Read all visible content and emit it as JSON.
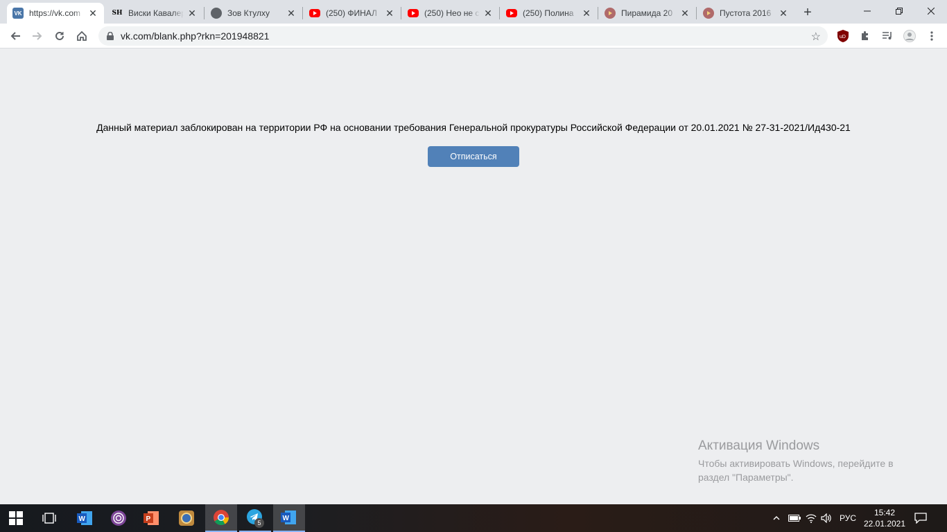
{
  "tabs": [
    {
      "title": "https://vk.com",
      "favicon": "vk-icon",
      "active": true
    },
    {
      "title": "Виски Кавалер",
      "favicon": "sh-icon",
      "active": false
    },
    {
      "title": "Зов Ктулху",
      "favicon": "globe-icon",
      "active": false
    },
    {
      "title": "(250) ФИНАЛ",
      "favicon": "youtube-icon",
      "active": false
    },
    {
      "title": "(250) Нео не с",
      "favicon": "youtube-icon",
      "active": false
    },
    {
      "title": "(250) Полина",
      "favicon": "youtube-icon",
      "active": false
    },
    {
      "title": "Пирамида 20",
      "favicon": "film-icon",
      "active": false
    },
    {
      "title": "Пустота 2016",
      "favicon": "film-icon",
      "active": false
    }
  ],
  "address_bar": {
    "url": "vk.com/blank.php?rkn=201948821"
  },
  "page": {
    "message": "Данный материал заблокирован на территории РФ на основании требования Генеральной прокуратуры Российской Федерации от 20.01.2021 № 27-31-2021/Ид430-21",
    "unsubscribe_label": "Отписаться"
  },
  "watermark": {
    "title": "Активация Windows",
    "line1": "Чтобы активировать Windows, перейдите в",
    "line2": "раздел \"Параметры\"."
  },
  "taskbar": {
    "language": "РУС",
    "time": "15:42",
    "date": "22.01.2021",
    "telegram_badge": "5"
  },
  "colors": {
    "vk_button": "#5181b8",
    "page_bg": "#edeef0",
    "tabstrip_bg": "#dee1e6"
  }
}
